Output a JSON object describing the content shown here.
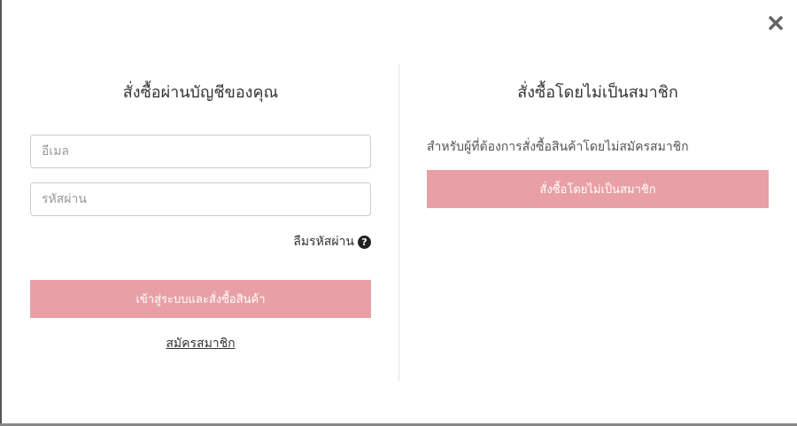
{
  "modal": {
    "close_icon": "close-icon"
  },
  "account_checkout": {
    "title": "สั่งซื้อผ่านบัญชีของคุณ",
    "email_placeholder": "อีเมล",
    "password_placeholder": "รหัสผ่าน",
    "forgot_password_label": "ลืมรหัสผ่าน",
    "forgot_password_icon": "question-circle-icon",
    "login_button_label": "เข้าสู่ระบบและสั่งซื้อสินค้า",
    "register_link_label": "สมัครสมาชิก"
  },
  "guest_checkout": {
    "title": "สั่งซื้อโดยไม่เป็นสมาชิก",
    "description": "สำหรับผู้ที่ต้องการสั่งซื้อสินค้าโดยไม่สมัครสมาชิก",
    "button_label": "สั่งซื้อโดยไม่เป็นสมาชิก"
  },
  "colors": {
    "button_background": "#e8a0a6",
    "button_text": "#ffffff",
    "close_icon": "#666666"
  }
}
